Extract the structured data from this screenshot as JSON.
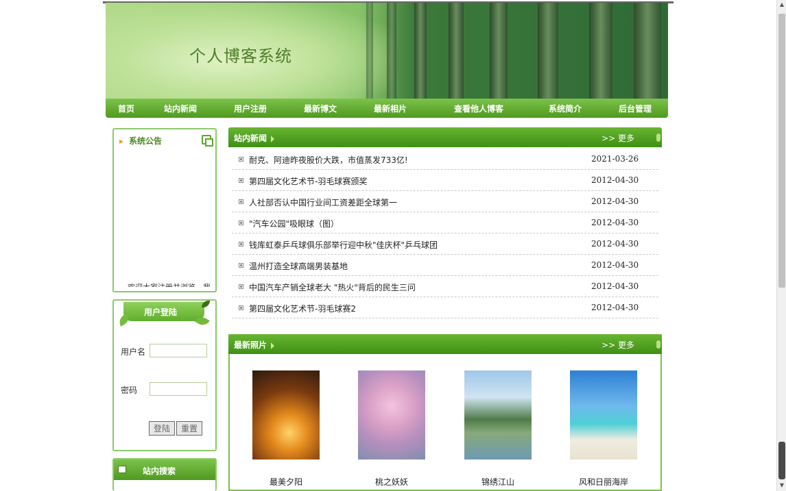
{
  "banner": {
    "title": "个人博客系统"
  },
  "nav": [
    "首页",
    "站内新闻",
    "用户注册",
    "最新博文",
    "最新相片",
    "查看他人博客",
    "系统简介",
    "后台管理"
  ],
  "notice": {
    "title": "系统公告",
    "scrolling_text": "欢迎大家注册并浏览，我站"
  },
  "login": {
    "title": "用户登陆",
    "username_label": "用户名",
    "password_label": "密码",
    "login_button": "登陆",
    "reset_button": "重置"
  },
  "search": {
    "title": "站内搜索"
  },
  "news": {
    "title": "站内新闻",
    "more": ">> 更多",
    "items": [
      {
        "title": "耐克、阿迪昨夜股价大跌，市值蒸发733亿!",
        "date": "2021-03-26"
      },
      {
        "title": "第四届文化艺术节-羽毛球赛颁奖",
        "date": "2012-04-30"
      },
      {
        "title": "人社部否认中国行业间工资差距全球第一",
        "date": "2012-04-30"
      },
      {
        "title": "\"汽车公园\"吸眼球（图）",
        "date": "2012-04-30"
      },
      {
        "title": "钱库虹泰乒乓球俱乐部举行迎中秋\"佳庆杯\"乒乓球团",
        "date": "2012-04-30"
      },
      {
        "title": "温州打造全球高端男装基地",
        "date": "2012-04-30"
      },
      {
        "title": "中国汽车产销全球老大 \"热火\"背后的民生三问",
        "date": "2012-04-30"
      },
      {
        "title": "第四届文化艺术节-羽毛球赛2",
        "date": "2012-04-30"
      }
    ]
  },
  "photos": {
    "title": "最新照片",
    "more": ">> 更多",
    "items": [
      {
        "caption": "最美夕阳"
      },
      {
        "caption": "桃之妖妖"
      },
      {
        "caption": "锦绣江山"
      },
      {
        "caption": "风和日丽海岸"
      }
    ]
  }
}
